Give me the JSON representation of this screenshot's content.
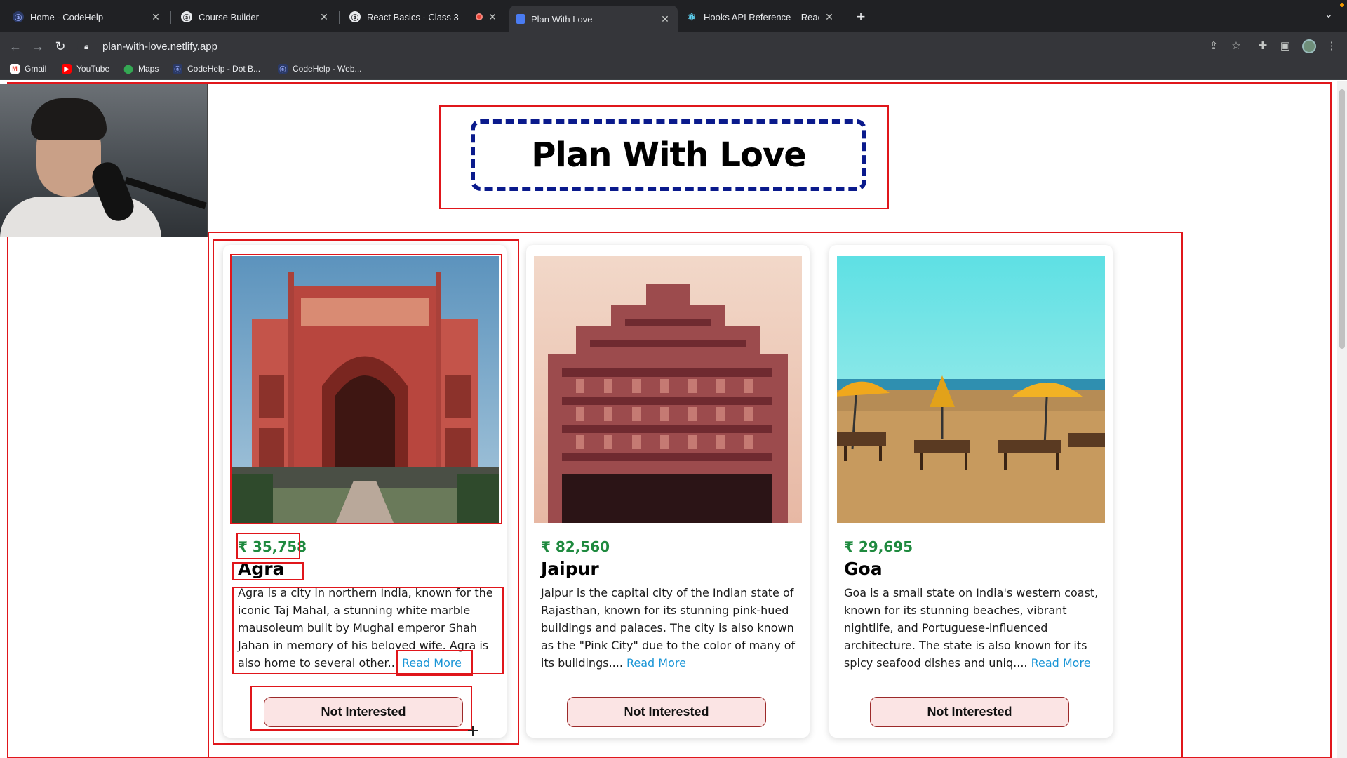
{
  "browser": {
    "tabs": [
      {
        "title": "Home - CodeHelp",
        "favicon": "codehelp-icon",
        "active": false
      },
      {
        "title": "Course Builder",
        "favicon": "codehelp-icon",
        "active": false
      },
      {
        "title": "React Basics - Class 3",
        "favicon": "codehelp-icon",
        "active": false,
        "recording": true
      },
      {
        "title": "Plan With Love",
        "favicon": "page-icon",
        "active": true
      },
      {
        "title": "Hooks API Reference – React",
        "favicon": "react-icon",
        "active": false
      }
    ],
    "new_tab_label": "+",
    "url": "plan-with-love.netlify.app",
    "bookmarks": [
      {
        "label": "Gmail",
        "icon": "gmail-icon"
      },
      {
        "label": "YouTube",
        "icon": "youtube-icon"
      },
      {
        "label": "Maps",
        "icon": "maps-icon"
      },
      {
        "label": "CodeHelp - Dot B...",
        "icon": "codehelp-icon"
      },
      {
        "label": "CodeHelp - Web...",
        "icon": "codehelp-icon"
      }
    ]
  },
  "page": {
    "title": "Plan With Love",
    "title_border_color": "#0a1a8c",
    "debug_outline_color": "#e0161b",
    "tours": [
      {
        "price": "₹ 35,758",
        "name": "Agra",
        "description": "Agra is a city in northern India, known for the iconic Taj Mahal, a stunning white marble mausoleum built by Mughal emperor Shah Jahan in memory of his beloved wife. Agra is also home to several other...",
        "read_more": "Read More",
        "button": "Not Interested",
        "image": "agra-fort-gate-image"
      },
      {
        "price": "₹ 82,560",
        "name": "Jaipur",
        "description": "Jaipur is the capital city of the Indian state of Rajasthan, known for its stunning pink-hued buildings and palaces. The city is also known as the \"Pink City\" due to the color of many of its buildings....",
        "read_more": "Read More",
        "button": "Not Interested",
        "image": "hawa-mahal-image"
      },
      {
        "price": "₹ 29,695",
        "name": "Goa",
        "description": "Goa is a small state on India's western coast, known for its stunning beaches, vibrant nightlife, and Portuguese-influenced architecture. The state is also known for its spicy seafood dishes and uniq....",
        "read_more": "Read More",
        "button": "Not Interested",
        "image": "goa-beach-image"
      }
    ],
    "price_color": "#1f8a3f",
    "link_color": "#1a95d6"
  }
}
